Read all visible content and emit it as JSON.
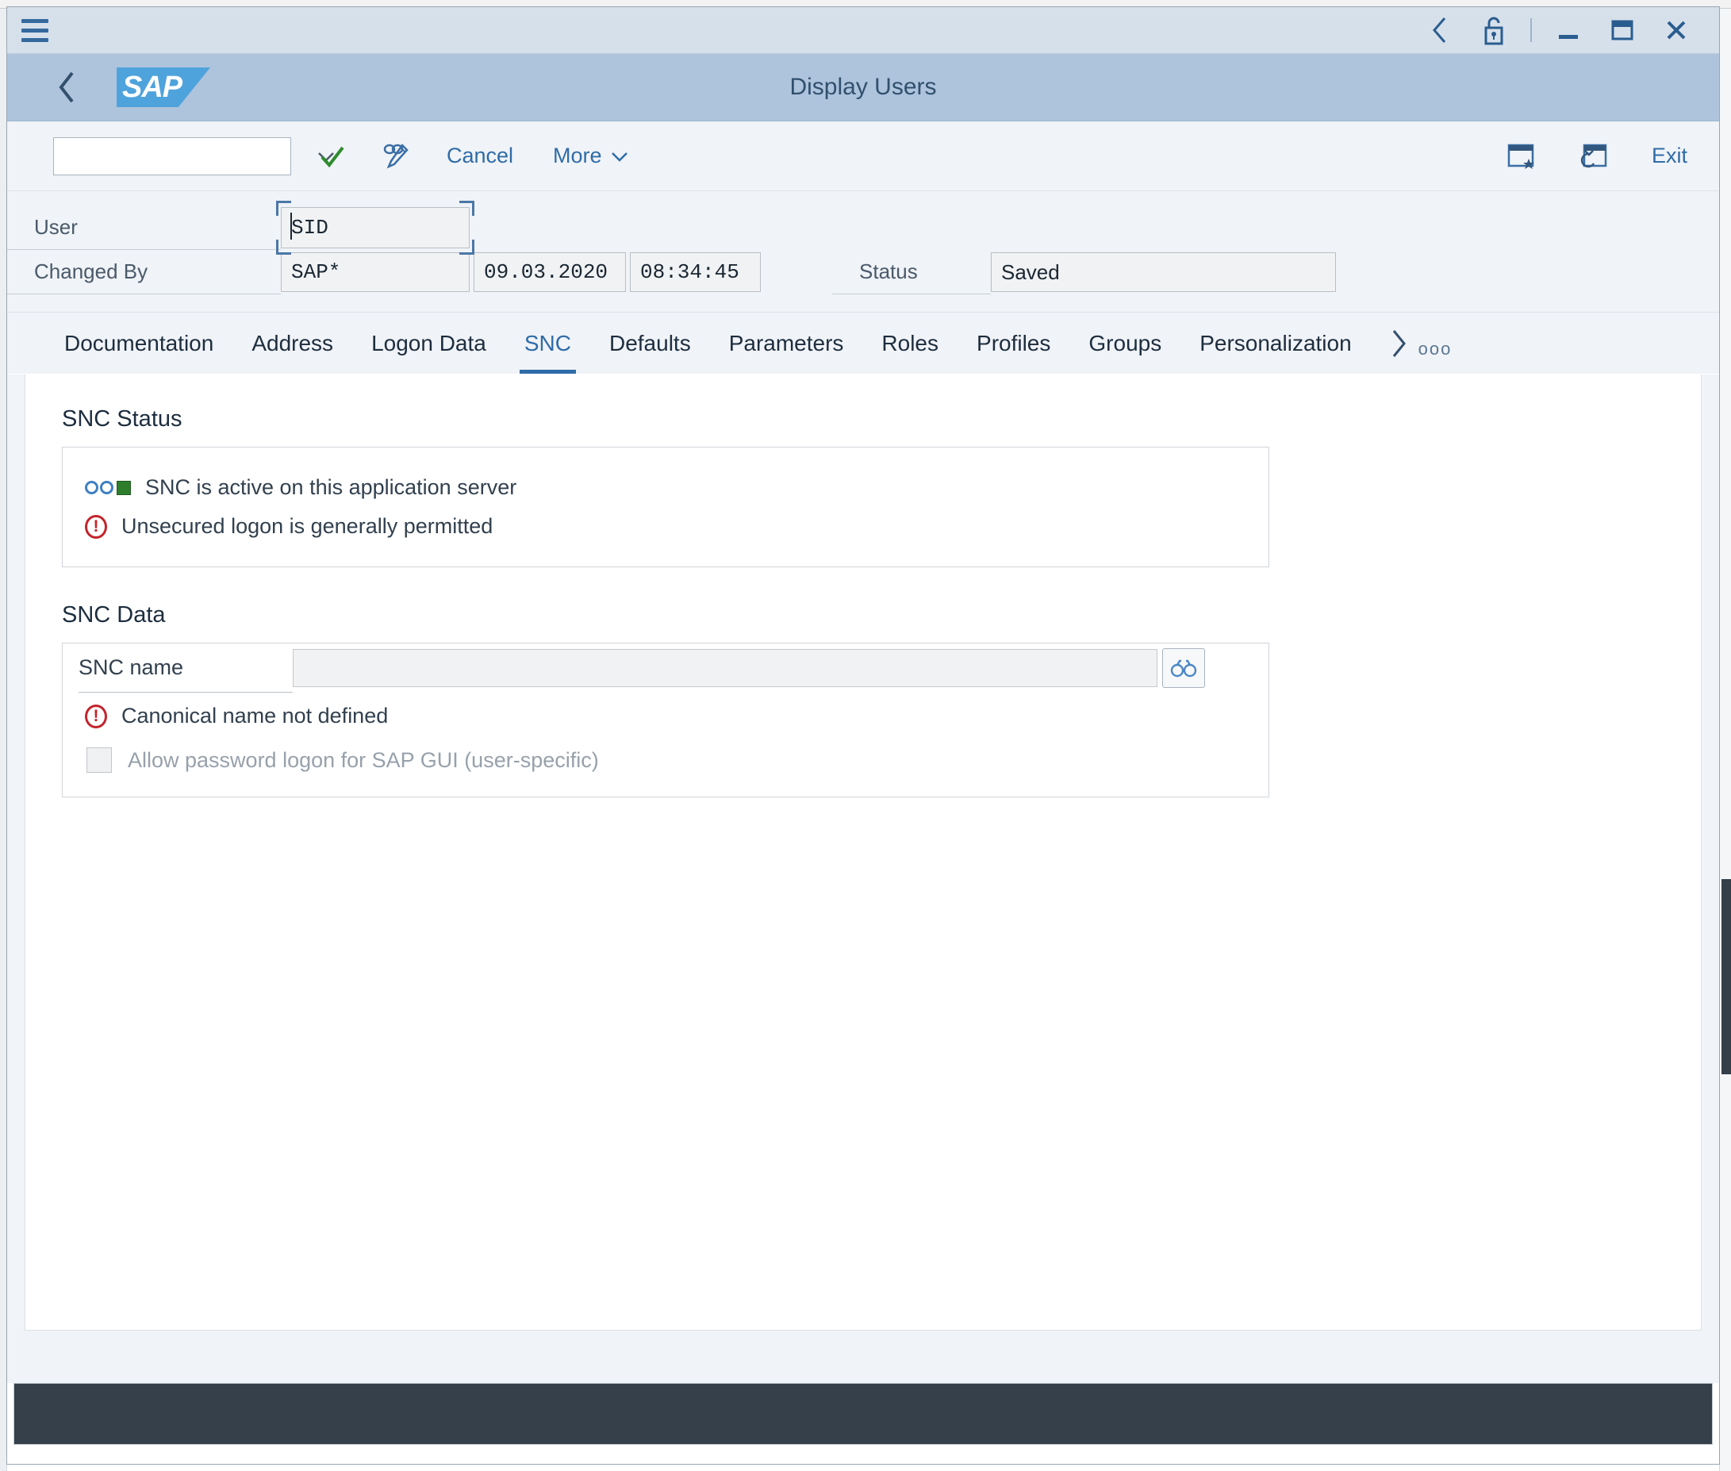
{
  "window": {
    "title": "Display Users",
    "menu_icon": "hamburger-menu-icon",
    "controls": [
      {
        "name": "history-back",
        "icon": "chevron-left-icon"
      },
      {
        "name": "lock",
        "icon": "unlock-padlock-icon"
      },
      {
        "name": "minimize",
        "icon": "minimize-icon"
      },
      {
        "name": "maximize",
        "icon": "maximize-icon"
      },
      {
        "name": "close",
        "icon": "close-icon"
      }
    ]
  },
  "shell": {
    "back_icon": "chevron-left-icon",
    "logo_text": "SAP",
    "title": "Display Users"
  },
  "toolbar": {
    "command_field_value": "",
    "command_field_placeholder": "",
    "command_dropdown_icon": "chevron-down-icon",
    "enter_icon": "green-checkmark-icon",
    "edit_icon": "display-change-pencil-icon",
    "cancel_label": "Cancel",
    "more_label": "More",
    "more_icon": "chevron-down-icon",
    "create_shortcut_icon": "create-shortcut-icon",
    "new_session_icon": "new-session-icon",
    "exit_label": "Exit"
  },
  "header_form": {
    "user_label": "User",
    "user_value": "SID",
    "changed_by_label": "Changed By",
    "changed_by_value": "SAP*",
    "changed_date": "09.03.2020",
    "changed_time": "08:34:45",
    "status_label": "Status",
    "status_value": "Saved"
  },
  "tabs": {
    "items": [
      {
        "label": "Documentation",
        "active": false
      },
      {
        "label": "Address",
        "active": false
      },
      {
        "label": "Logon Data",
        "active": false
      },
      {
        "label": "SNC",
        "active": true
      },
      {
        "label": "Defaults",
        "active": false
      },
      {
        "label": "Parameters",
        "active": false
      },
      {
        "label": "Roles",
        "active": false
      },
      {
        "label": "Profiles",
        "active": false
      },
      {
        "label": "Groups",
        "active": false
      },
      {
        "label": "Personalization",
        "active": false
      }
    ],
    "overflow_chevron_icon": "chevron-right-icon",
    "overflow_dots": "ooo"
  },
  "snc_status": {
    "group_title": "SNC Status",
    "lines": [
      {
        "icon": "traffic-light-green-icon",
        "text": "SNC is active on this application server"
      },
      {
        "icon": "red-alert-icon",
        "text": "Unsecured logon is generally permitted"
      }
    ]
  },
  "snc_data": {
    "group_title": "SNC Data",
    "snc_name_label": "SNC name",
    "snc_name_value": "",
    "snc_name_placeholder": "",
    "value_help_icon": "binoculars-icon",
    "canonical_icon": "red-alert-icon",
    "canonical_message": "Canonical name not defined",
    "allow_password_label": "Allow password logon for SAP GUI (user-specific)",
    "allow_password_checked": false,
    "allow_password_disabled": true
  },
  "status_bar": {
    "message": ""
  },
  "colors": {
    "shell_bar": "#aec4dc",
    "title_bar": "#d6e0eb",
    "accent": "#2f6ca8",
    "sap_logo": "#4fa3dc",
    "alert_red": "#c4242b",
    "status_green": "#2d7d2d",
    "status_bar_bg": "#35404a"
  }
}
